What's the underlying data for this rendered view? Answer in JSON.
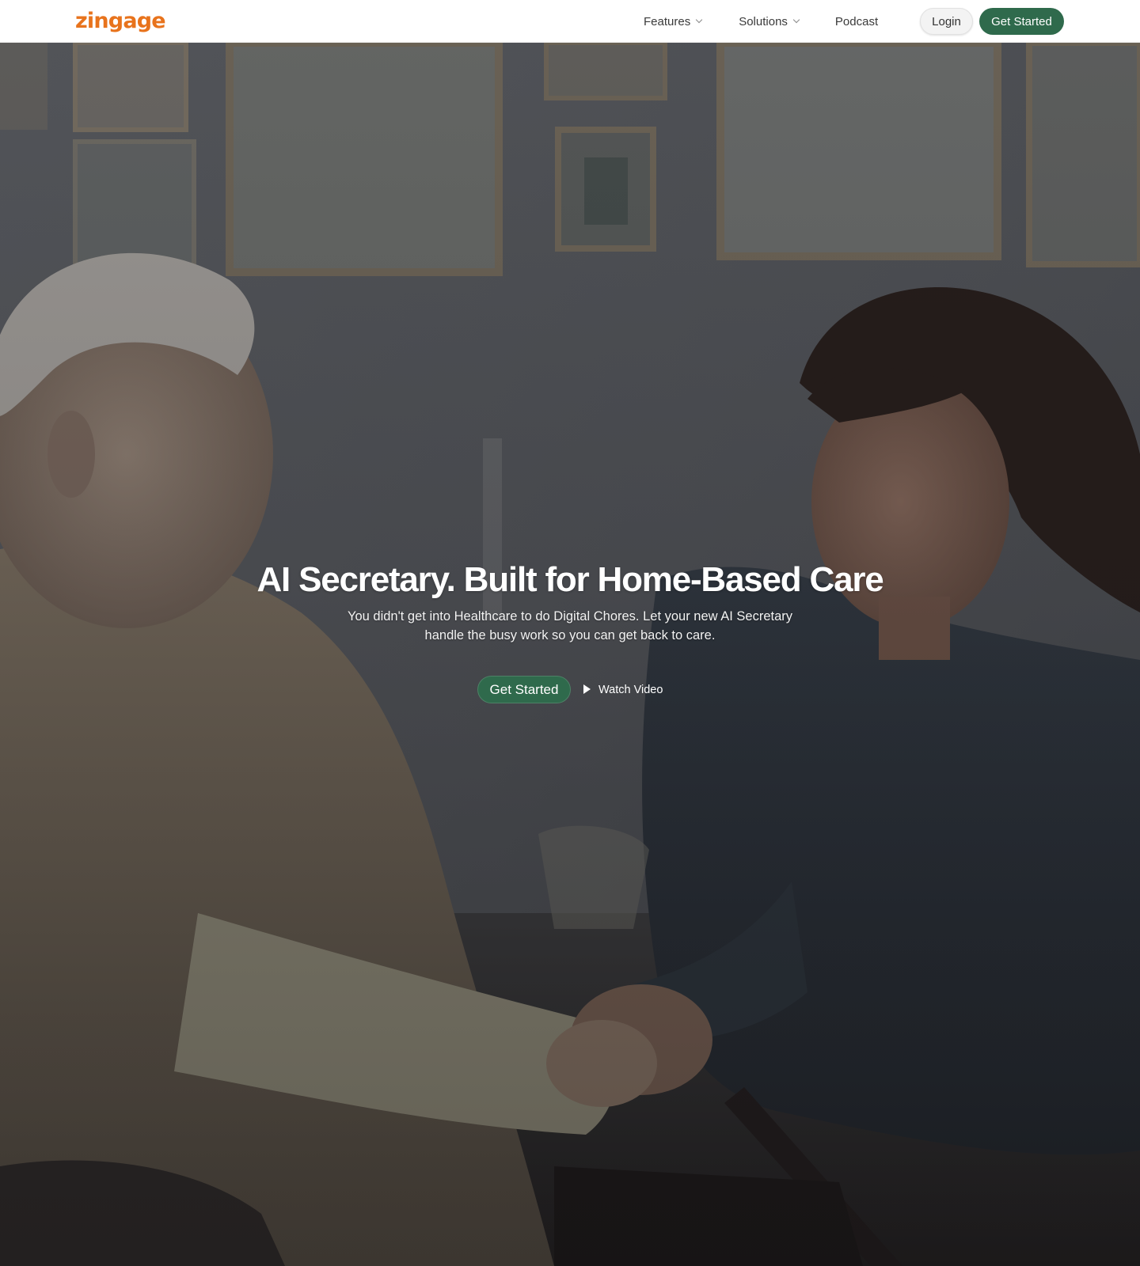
{
  "brand": {
    "logo_text": "zingage",
    "logo_color": "#e8731c"
  },
  "nav": {
    "items": [
      {
        "label": "Features",
        "has_dropdown": true,
        "icon": "chevron-down-icon"
      },
      {
        "label": "Solutions",
        "has_dropdown": true,
        "icon": "chevron-down-icon"
      },
      {
        "label": "Podcast",
        "has_dropdown": false
      }
    ],
    "login_label": "Login",
    "cta_label": "Get Started"
  },
  "hero": {
    "title": "AI Secretary. Built for Home-Based Care",
    "subtitle": "You didn't get into Healthcare to do Digital Chores. Let your new AI Secretary handle the busy work so you can get back to care.",
    "cta_label": "Get Started",
    "video_label": "Watch Video",
    "video_icon": "play-icon",
    "background_image": "caregiver-holding-elderly-man-hands-photo"
  },
  "colors": {
    "accent_green": "#2f6a4c",
    "brand_orange": "#e8731c"
  }
}
